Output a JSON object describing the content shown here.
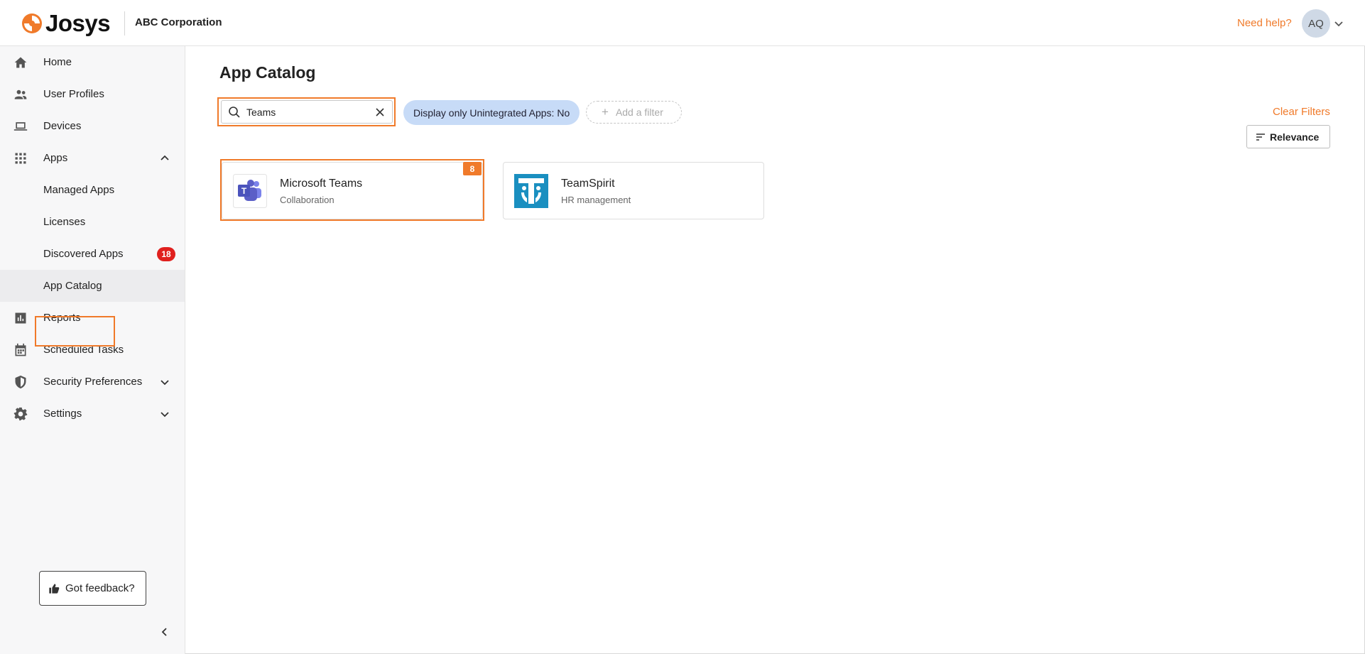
{
  "header": {
    "brand": "Josys",
    "organization": "ABC Corporation",
    "help_link": "Need help?",
    "avatar_initials": "AQ"
  },
  "sidebar": {
    "items": [
      {
        "label": "Home",
        "icon": "home-icon"
      },
      {
        "label": "User Profiles",
        "icon": "users-icon"
      },
      {
        "label": "Devices",
        "icon": "laptop-icon"
      },
      {
        "label": "Apps",
        "icon": "apps-grid-icon",
        "expanded": true
      },
      {
        "label": "Managed Apps"
      },
      {
        "label": "Licenses"
      },
      {
        "label": "Discovered Apps",
        "badge": "18"
      },
      {
        "label": "App Catalog",
        "active": true
      },
      {
        "label": "Reports",
        "icon": "reports-icon"
      },
      {
        "label": "Scheduled Tasks",
        "icon": "calendar-icon"
      },
      {
        "label": "Security Preferences",
        "icon": "shield-icon",
        "expandable": true
      },
      {
        "label": "Settings",
        "icon": "gear-icon",
        "expandable": true
      }
    ],
    "feedback_label": "Got feedback?"
  },
  "main": {
    "title": "App Catalog",
    "search": {
      "value": "Teams"
    },
    "filter_chip": "Display only Unintegrated Apps: No",
    "add_filter": "Add a filter",
    "clear_filters": "Clear Filters",
    "sort_label": "Relevance",
    "apps": [
      {
        "name": "Microsoft Teams",
        "category": "Collaboration",
        "badge": "8"
      },
      {
        "name": "TeamSpirit",
        "category": "HR management"
      }
    ]
  },
  "colors": {
    "accent": "#f07a2a",
    "badge_red": "#e0201e",
    "chip_blue": "#c7dbf7",
    "teams_purple": "#5b5fc7",
    "teamspirit_blue": "#1a8fc0"
  }
}
